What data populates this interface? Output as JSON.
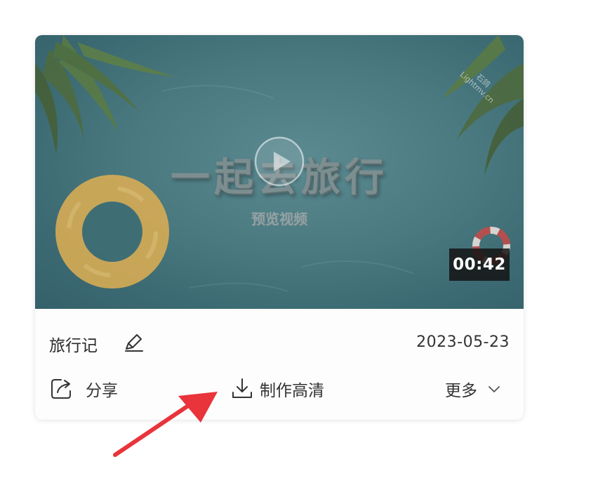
{
  "video": {
    "title_overlay": "一起去旅行",
    "subtitle_overlay": "预览视频",
    "watermark_line1": "石鸽",
    "watermark_line2": "Lightmv.cn",
    "duration": "00:42",
    "name": "旅行记",
    "date": "2023-05-23"
  },
  "actions": {
    "share_label": "分享",
    "hd_label": "制作高清",
    "more_label": "更多"
  },
  "icons": {
    "play": "play-icon",
    "edit": "pencil-icon",
    "share": "share-icon",
    "download": "download-icon",
    "more": "chevron-down-icon",
    "arrow": "red-arrow-annotation"
  },
  "colors": {
    "accent_arrow": "#e8343a",
    "card_bg": "#fdfdfe",
    "text": "#333333"
  }
}
